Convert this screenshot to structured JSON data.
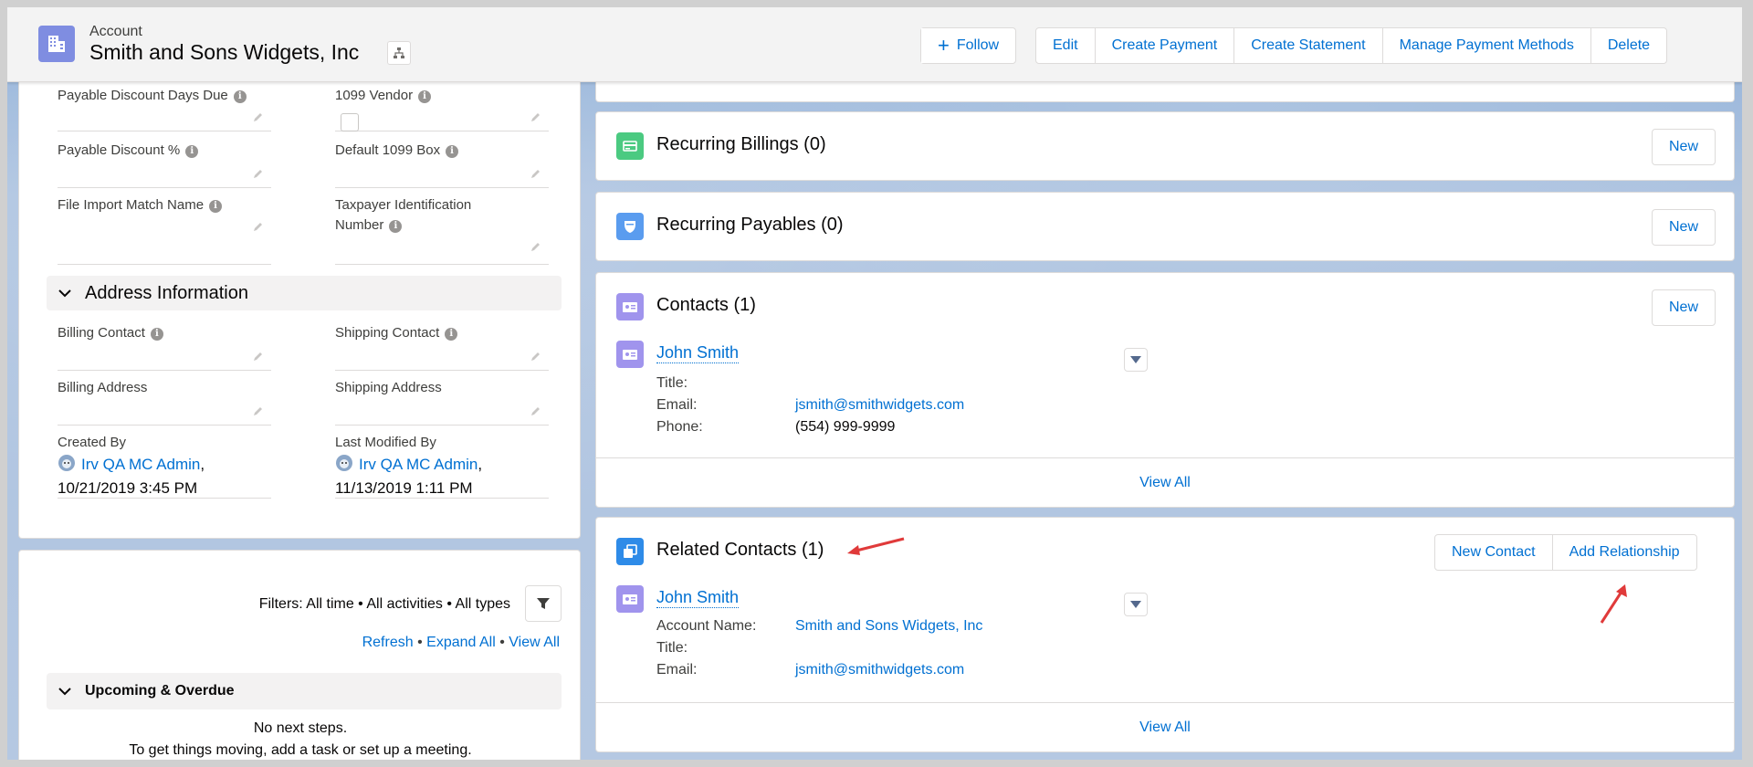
{
  "header": {
    "object_type": "Account",
    "title": "Smith and Sons Widgets, Inc",
    "buttons": [
      "Follow",
      "Edit",
      "Create Payment",
      "Create Statement",
      "Manage Payment Methods",
      "Delete"
    ]
  },
  "details": {
    "payable_discount_days_due": "Payable Discount Days Due",
    "vendor_1099": "1099 Vendor",
    "payable_discount_pct": "Payable Discount %",
    "default_1099_box": "Default 1099 Box",
    "file_import_match_name": "File Import Match Name",
    "taxpayer_id_line1": "Taxpayer Identification",
    "taxpayer_id_line2": "Number",
    "address_section": "Address Information",
    "billing_contact": "Billing Contact",
    "shipping_contact": "Shipping Contact",
    "billing_address": "Billing Address",
    "shipping_address": "Shipping Address",
    "created_by_label": "Created By",
    "created_by_user": "Irv QA MC Admin",
    "created_by_date": "10/21/2019 3:45 PM",
    "last_modified_label": "Last Modified By",
    "last_modified_user": "Irv QA MC Admin",
    "last_modified_date": "11/13/2019 1:11 PM",
    "comma": ","
  },
  "activity": {
    "filters": "Filters: All time • All activities • All types",
    "refresh": "Refresh",
    "expand_all": "Expand All",
    "view_all": "View All",
    "sep": "•",
    "upcoming": "Upcoming & Overdue",
    "no_steps": "No next steps.",
    "hint": "To get things moving, add a task or set up a meeting."
  },
  "related": {
    "recurring_billings": {
      "title": "Recurring Billings (0)",
      "new": "New"
    },
    "recurring_payables": {
      "title": "Recurring Payables (0)",
      "new": "New"
    },
    "contacts": {
      "title": "Contacts (1)",
      "new": "New",
      "name": "John Smith",
      "title_label": "Title:",
      "email_label": "Email:",
      "email": "jsmith@smithwidgets.com",
      "phone_label": "Phone:",
      "phone": "(554) 999-9999",
      "view_all": "View All"
    },
    "related_contacts": {
      "title": "Related Contacts (1)",
      "new_contact": "New Contact",
      "add_relationship": "Add Relationship",
      "name": "John Smith",
      "account_label": "Account Name:",
      "account": "Smith and Sons Widgets, Inc",
      "title_label": "Title:",
      "email_label": "Email:",
      "email": "jsmith@smithwidgets.com",
      "view_all": "View All"
    }
  },
  "colors": {
    "brand_link": "#0070d2",
    "account_icon": "#7f8de1",
    "billing_icon": "#4bca81",
    "payables_icon": "#5a9cef",
    "contact_icon": "#a094ed",
    "related_contacts_icon": "#2e8be8",
    "annotation_arrow": "#e03a3a"
  }
}
